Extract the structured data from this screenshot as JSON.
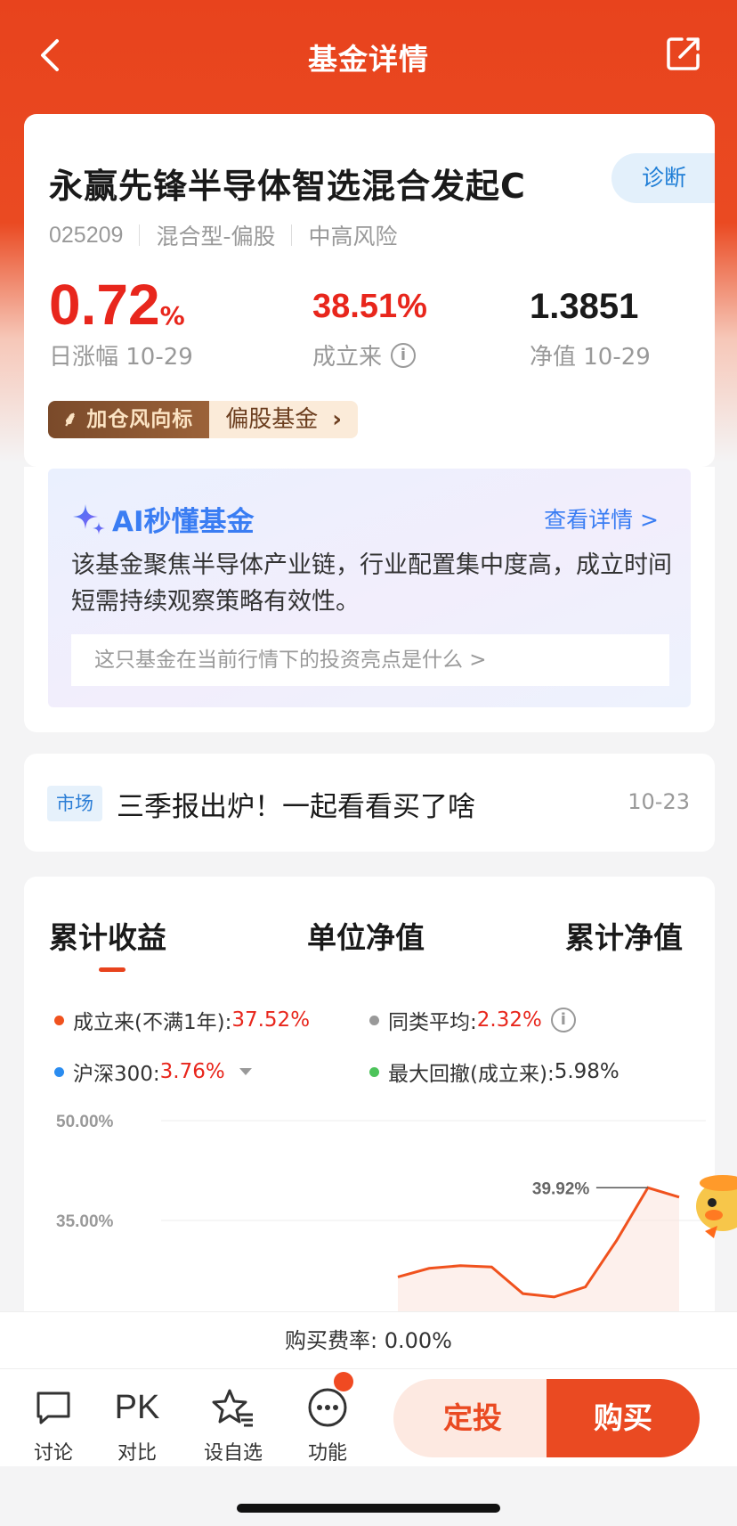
{
  "nav": {
    "title": "基金详情"
  },
  "fund": {
    "name": "永赢先锋半导体智选混合发起C",
    "diagnose_label": "诊断",
    "code": "025209",
    "type": "混合型-偏股",
    "risk": "中高风险",
    "daily_change": "0.72",
    "daily_change_unit": "%",
    "daily_change_label": "日涨幅 10-29",
    "since_inception": "38.51%",
    "since_inception_label": "成立来",
    "nav_value": "1.3851",
    "nav_label": "净值 10-29",
    "tag_badge": "加仓风向标",
    "tag_category": "偏股基金"
  },
  "ai": {
    "title": "AI秒懂基金",
    "more": "查看详情 >",
    "summary": "该基金聚焦半导体产业链，行业配置集中度高，成立时间短需持续观察策略有效性。",
    "question": "这只基金在当前行情下的投资亮点是什么 >"
  },
  "news": {
    "tag": "市场",
    "title": "三季报出炉！一起看看买了啥",
    "date": "10-23"
  },
  "chart_tabs": [
    "累计收益",
    "单位净值",
    "累计净值"
  ],
  "legend": {
    "inception": {
      "label": "成立来(不满1年): ",
      "value": "37.52%"
    },
    "peer_avg": {
      "label": "同类平均: ",
      "value": "2.32%"
    },
    "csi300": {
      "label": "沪深300: ",
      "value": "3.76%"
    },
    "max_drawdown": {
      "label": "最大回撤(成立来): ",
      "value": "5.98%"
    }
  },
  "colors": {
    "brand": "#ea4a22",
    "up_red": "#e8261c",
    "dot_orange": "#f0521e",
    "dot_gray": "#999999",
    "dot_blue": "#2a8cf0",
    "dot_green": "#4cc35a"
  },
  "chart_data": {
    "type": "line",
    "y_ticks": [
      "50.00%",
      "35.00%"
    ],
    "ylim": [
      20,
      50
    ],
    "peak_label": "39.92%",
    "series": [
      {
        "values": [
          26.5,
          27.8,
          28.2,
          28.0,
          24.0,
          23.5,
          25.0,
          32.0,
          39.92,
          38.5
        ]
      }
    ]
  },
  "fee": "购买费率: 0.00%",
  "actions": {
    "discuss": "讨论",
    "compare_icon": "PK",
    "compare": "对比",
    "watchlist": "设自选",
    "more": "功能"
  },
  "buttons": {
    "sip": "定投",
    "buy": "购买"
  }
}
